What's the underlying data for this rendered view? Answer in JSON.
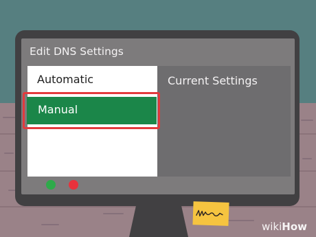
{
  "window": {
    "title": "Edit DNS Settings"
  },
  "options": {
    "automatic_label": "Automatic",
    "manual_label": "Manual",
    "selected": "Manual"
  },
  "details": {
    "title": "Current Settings"
  },
  "watermark": {
    "text_prefix": "wiki",
    "text_suffix": "How"
  },
  "colors": {
    "selection": "#1b8649",
    "highlight_outline": "#e33a3d",
    "indicator_green": "#2eaa4a",
    "indicator_red": "#e8323c",
    "sticky_note": "#f6c440"
  },
  "icons": {
    "power_indicator_green": "status-dot",
    "power_indicator_red": "status-dot",
    "sticky_note": "note-with-scribble"
  }
}
